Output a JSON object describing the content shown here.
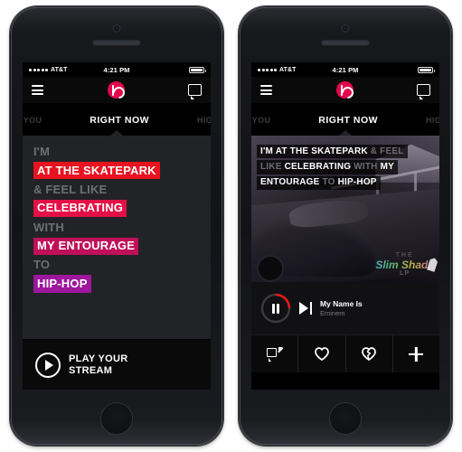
{
  "colors": {
    "beats_red": "#e3064c",
    "hl_skatepark": "#e8131f",
    "hl_celebrating": "#e31046",
    "hl_entourage": "#bf1059",
    "hl_hiphop": "#9c179e",
    "progress_red": "#e01b1b",
    "panel_bg": "#222326",
    "screen_bg": "#000000"
  },
  "status_bar": {
    "signal_dots": 5,
    "carrier": "AT&T",
    "clock": "4:21 PM",
    "battery_icon": "battery-full-icon"
  },
  "nav_bar": {
    "menu_icon": "hamburger-menu-icon",
    "logo_icon": "beats-music-logo-icon",
    "chat_icon": "chat-bubble-icon"
  },
  "tabs": [
    {
      "label": "R YOU",
      "full_label": "FOR YOU",
      "active": false
    },
    {
      "label": "RIGHT NOW",
      "full_label": "RIGHT NOW",
      "active": true
    },
    {
      "label": "HIGHL",
      "full_label": "HIGHLIGHTS",
      "active": false
    }
  ],
  "left_phone": {
    "lyrics": [
      {
        "text": "I'M",
        "style": "plain",
        "color": ""
      },
      {
        "text": "AT THE SKATEPARK",
        "style": "highlight",
        "color": "#e8131f"
      },
      {
        "text": "& FEEL LIKE",
        "style": "plain",
        "color": ""
      },
      {
        "text": "CELEBRATING",
        "style": "highlight",
        "color": "#e31046"
      },
      {
        "text": "WITH",
        "style": "plain",
        "color": ""
      },
      {
        "text": "MY ENTOURAGE",
        "style": "highlight",
        "color": "#bf1059"
      },
      {
        "text": "TO",
        "style": "plain",
        "color": ""
      },
      {
        "text": "HIP-HOP",
        "style": "highlight",
        "color": "#9c179e"
      }
    ],
    "play_button": {
      "icon": "play-circle-icon",
      "line1": "PLAY YOUR",
      "line2": "STREAM"
    }
  },
  "right_phone": {
    "album_art": {
      "watermark_the": "THE",
      "watermark_title": "Slim Shady",
      "watermark_lp": "LP",
      "pen_icon": "marker-pen-icon"
    },
    "overlay_lyrics": [
      [
        {
          "text": "I'M ",
          "emphasis": "on"
        },
        {
          "text": "AT THE SKATEPARK ",
          "emphasis": "on"
        },
        {
          "text": "& FEEL",
          "emphasis": "off"
        }
      ],
      [
        {
          "text": "LIKE ",
          "emphasis": "off"
        },
        {
          "text": "CELEBRATING ",
          "emphasis": "on"
        },
        {
          "text": "WITH ",
          "emphasis": "off"
        },
        {
          "text": "MY",
          "emphasis": "on"
        }
      ],
      [
        {
          "text": "ENTOURAGE ",
          "emphasis": "on"
        },
        {
          "text": "TO ",
          "emphasis": "off"
        },
        {
          "text": "HIP-HOP",
          "emphasis": "on"
        }
      ]
    ],
    "now_playing": {
      "pause_icon": "pause-icon",
      "progress_percent": 25,
      "next_icon": "next-track-icon",
      "track_title": "My Name Is",
      "track_artist": "Eminem"
    },
    "actions": [
      {
        "icon": "share-comment-icon",
        "name": "share"
      },
      {
        "icon": "heart-icon",
        "name": "like"
      },
      {
        "icon": "broken-heart-icon",
        "name": "dislike"
      },
      {
        "icon": "plus-icon",
        "name": "add"
      }
    ]
  }
}
